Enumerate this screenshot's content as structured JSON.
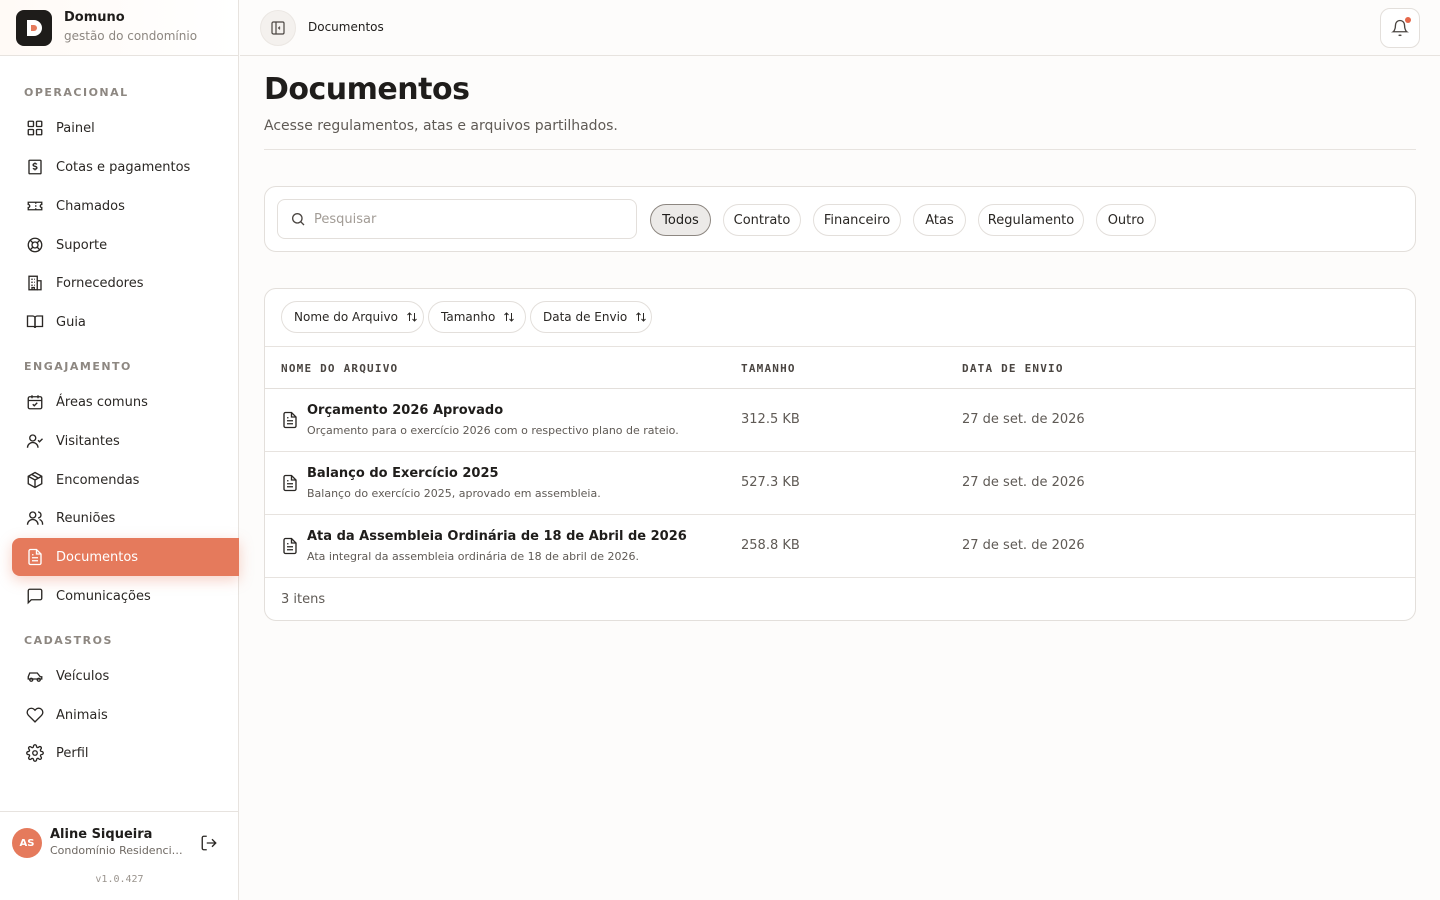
{
  "brand": {
    "name": "Domuno",
    "subtitle": "gestão do condomínio"
  },
  "sidebar": {
    "sections": [
      {
        "title": "OPERACIONAL"
      },
      {
        "title": "ENGAJAMENTO"
      },
      {
        "title": "CADASTROS"
      }
    ],
    "items": [
      {
        "label": "Painel",
        "icon": "grid-icon"
      },
      {
        "label": "Cotas e pagamentos",
        "icon": "receipt-dollar-icon"
      },
      {
        "label": "Chamados",
        "icon": "ticket-icon"
      },
      {
        "label": "Suporte",
        "icon": "lifebuoy-icon"
      },
      {
        "label": "Fornecedores",
        "icon": "building-icon"
      },
      {
        "label": "Guia",
        "icon": "book-icon"
      },
      {
        "label": "Áreas comuns",
        "icon": "calendar-check-icon"
      },
      {
        "label": "Visitantes",
        "icon": "user-check-icon"
      },
      {
        "label": "Encomendas",
        "icon": "package-icon"
      },
      {
        "label": "Reuniões",
        "icon": "users-icon"
      },
      {
        "label": "Documentos",
        "icon": "file-text-icon",
        "active": true
      },
      {
        "label": "Comunicações",
        "icon": "message-square-icon"
      },
      {
        "label": "Veículos",
        "icon": "car-icon"
      },
      {
        "label": "Animais",
        "icon": "heart-icon"
      },
      {
        "label": "Perfil",
        "icon": "gear-icon"
      }
    ]
  },
  "user": {
    "initials": "AS",
    "name": "Aline Siqueira",
    "org": "Condomínio Residencial ...",
    "version": "v1.0.427"
  },
  "topbar": {
    "breadcrumb": "Documentos"
  },
  "page": {
    "title": "Documentos",
    "subtitle": "Acesse regulamentos, atas e arquivos partilhados."
  },
  "filters": {
    "search_placeholder": "Pesquisar",
    "chips": [
      "Todos",
      "Contrato",
      "Financeiro",
      "Atas",
      "Regulamento",
      "Outro"
    ],
    "active_chip": "Todos"
  },
  "sort": [
    "Nome do Arquivo",
    "Tamanho",
    "Data de Envio"
  ],
  "table": {
    "columns": [
      "NOME DO ARQUIVO",
      "TAMANHO",
      "DATA DE ENVIO"
    ],
    "rows": [
      {
        "title": "Orçamento 2026 Aprovado",
        "desc": "Orçamento para o exercício 2026 com o respectivo plano de rateio.",
        "size": "312.5 KB",
        "date": "27 de set. de 2026"
      },
      {
        "title": "Balanço do Exercício 2025",
        "desc": "Balanço do exercício 2025, aprovado em assembleia.",
        "size": "527.3 KB",
        "date": "27 de set. de 2026"
      },
      {
        "title": "Ata da Assembleia Ordinária de 18 de Abril de 2026",
        "desc": "Ata integral da assembleia ordinária de 18 de abril de 2026.",
        "size": "258.8 KB",
        "date": "27 de set. de 2026"
      }
    ],
    "count": "3 itens"
  },
  "colors": {
    "accent": "#e57a5c",
    "notification_dot": "#e5674a"
  }
}
